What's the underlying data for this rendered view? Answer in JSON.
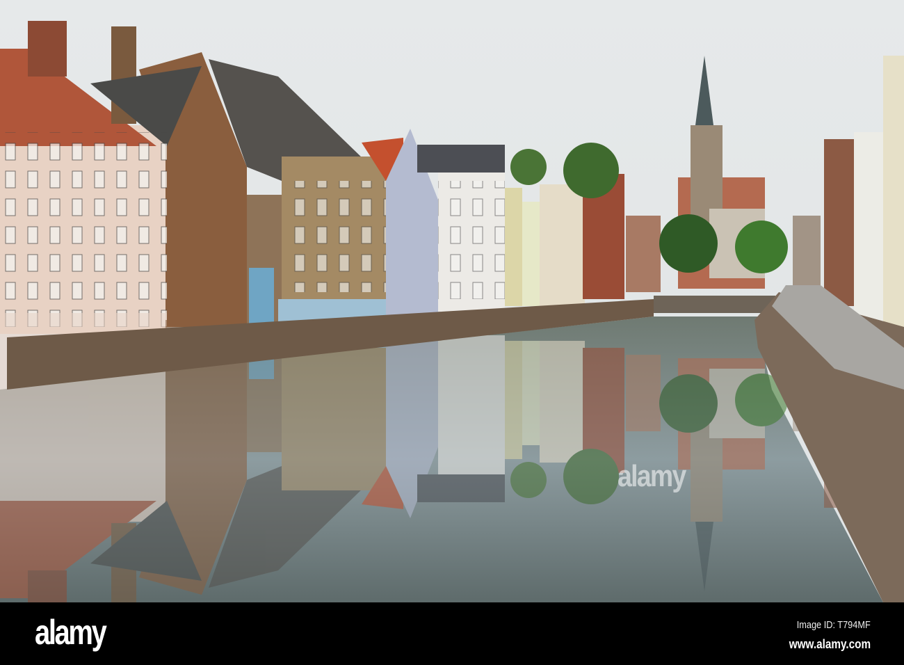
{
  "watermark": {
    "text": "alamy"
  },
  "footer": {
    "logo": "alamy",
    "image_id": "Image ID: T794MF",
    "website": "www.alamy.com"
  },
  "colors": {
    "sky": "#e4e7e9",
    "water": "#8a9aa0",
    "brick": "#8a5a3e",
    "footer": "#000000"
  }
}
